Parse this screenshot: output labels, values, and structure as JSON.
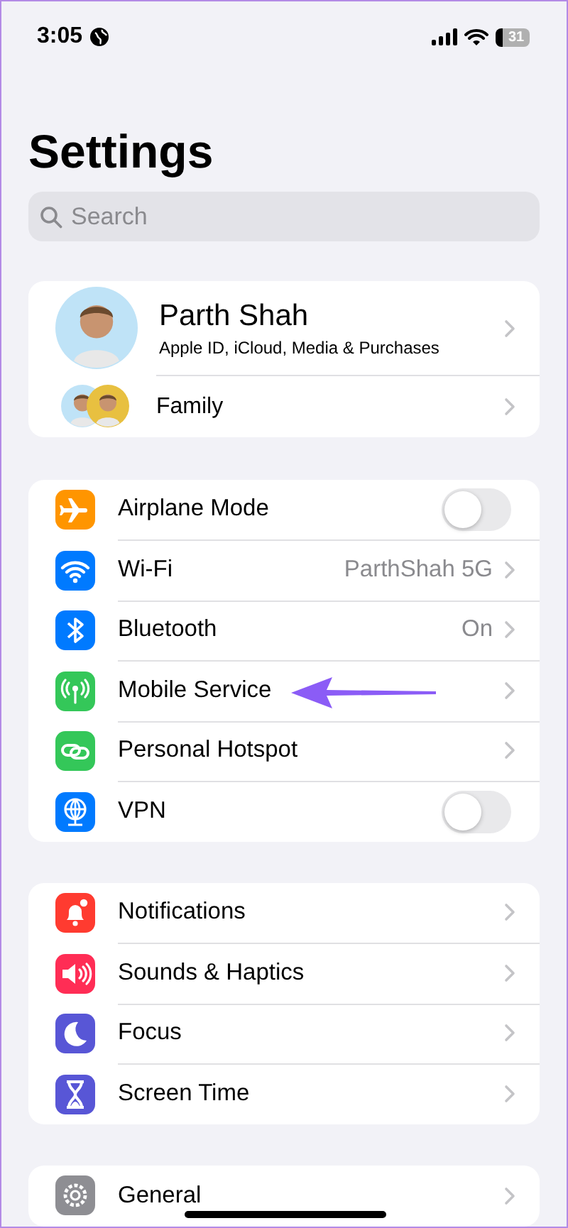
{
  "status_bar": {
    "time": "3:05",
    "battery": "31"
  },
  "title": "Settings",
  "search": {
    "placeholder": "Search"
  },
  "account": {
    "name": "Parth Shah",
    "subtitle": "Apple ID, iCloud, Media & Purchases",
    "family": "Family"
  },
  "groups": [
    {
      "rows": [
        {
          "kind": "toggle",
          "label": "Airplane Mode",
          "color": "#ff9500",
          "on": false,
          "arrow": false
        },
        {
          "kind": "link",
          "label": "Wi-Fi",
          "value": "ParthShah 5G",
          "color": "#007aff",
          "arrow": false
        },
        {
          "kind": "link",
          "label": "Bluetooth",
          "value": "On",
          "color": "#007aff",
          "arrow": false
        },
        {
          "kind": "link",
          "label": "Mobile Service",
          "color": "#34c759",
          "arrow": true
        },
        {
          "kind": "link",
          "label": "Personal Hotspot",
          "color": "#34c759",
          "arrow": false
        },
        {
          "kind": "toggle",
          "label": "VPN",
          "color": "#007aff",
          "on": false,
          "arrow": false
        }
      ]
    },
    {
      "rows": [
        {
          "kind": "link",
          "label": "Notifications",
          "color": "#ff3b30",
          "arrow": false
        },
        {
          "kind": "link",
          "label": "Sounds & Haptics",
          "color": "#ff2d55",
          "arrow": false
        },
        {
          "kind": "link",
          "label": "Focus",
          "color": "#5856d6",
          "arrow": false
        },
        {
          "kind": "link",
          "label": "Screen Time",
          "color": "#5856d6",
          "arrow": false
        }
      ]
    },
    {
      "rows": [
        {
          "kind": "link",
          "label": "General",
          "color": "#8e8e93",
          "arrow": false
        }
      ]
    }
  ]
}
